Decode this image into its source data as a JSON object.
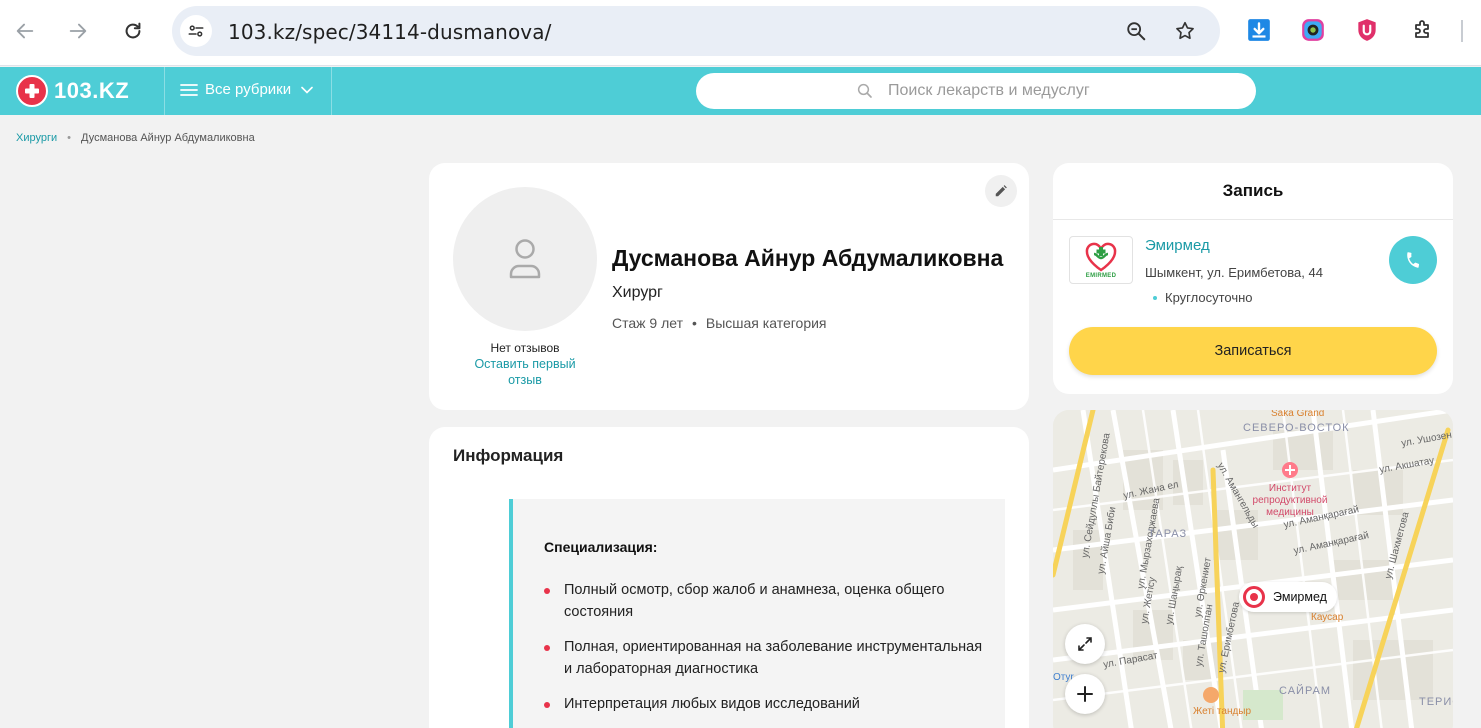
{
  "browser": {
    "url": "103.kz/spec/34114-dusmanova/"
  },
  "header": {
    "logo_text": "103.KZ",
    "rubrics_label": "Все рубрики",
    "search_placeholder": "Поиск лекарств и медуслуг"
  },
  "breadcrumb": {
    "parent": "Хирурги",
    "separator": "•",
    "current": "Дусманова Айнур Абдумаликовна"
  },
  "profile": {
    "name": "Дусманова Айнур Абдумаликовна",
    "specialty": "Хирург",
    "experience": "Стаж 9 лет",
    "meta_separator": "•",
    "category": "Высшая категория",
    "no_reviews": "Нет отзывов",
    "leave_review": "Оставить первый отзыв"
  },
  "info": {
    "title": "Информация",
    "spec_heading": "Специализация:",
    "items": [
      "Полный осмотр, сбор жалоб и анамнеза, оценка общего состояния",
      "Полная, ориентированная на заболевание инструментальная и лабораторная диагностика",
      "Интерпретация любых видов исследований"
    ]
  },
  "booking": {
    "title": "Запись",
    "clinic_logo_text": "EMIRMED",
    "clinic_name": "Эмирмед",
    "clinic_address": "Шымкент, ул. Еримбетова, 44",
    "clinic_hours": "Круглосуточно",
    "book_button": "Записаться"
  },
  "map": {
    "marker_label": "Эмирмед",
    "labels": {
      "saka": "Saka Grand",
      "severo": "СЕВЕРО-ВОСТОК",
      "ushozen": "ул. Ушозен",
      "akshatau": "ул. Акшатау",
      "institute": "Институт репродуктивной медицины",
      "baiterekova": "ул. Сейдуллы Байтерекова",
      "zhana_el": "ул. Жана ел",
      "amangeldi": "ул. Амангельды",
      "aisha": "ул. Айша Биби",
      "mirzahod": "ул. Мырзаходжаева",
      "taraz": "ТАРАЗ",
      "amankaragai_1": "ул. Аманқарағай",
      "amankaragai_2": "ул. Аманқарағай",
      "shakhmetova": "ул. Шахметова",
      "zhetysu": "ул. Жетісу",
      "shanyrak": "ул. Шаңырақ",
      "orkeniet": "ул. Өркениет",
      "tashkent": "ул. Ташолпан",
      "erimbetova": "ул. Еримбетова",
      "kausar": "Каусар",
      "parasat": "ул. Парасат",
      "sairam": "САЙРАМ",
      "zhetitandyr": "Жеті тандыр",
      "otyr": "Отyr",
      "teris": "ТЕРИС"
    }
  },
  "colors": {
    "brand": "#4ecdd6",
    "accent_red": "#e8334a",
    "book_yellow": "#ffd54a"
  }
}
